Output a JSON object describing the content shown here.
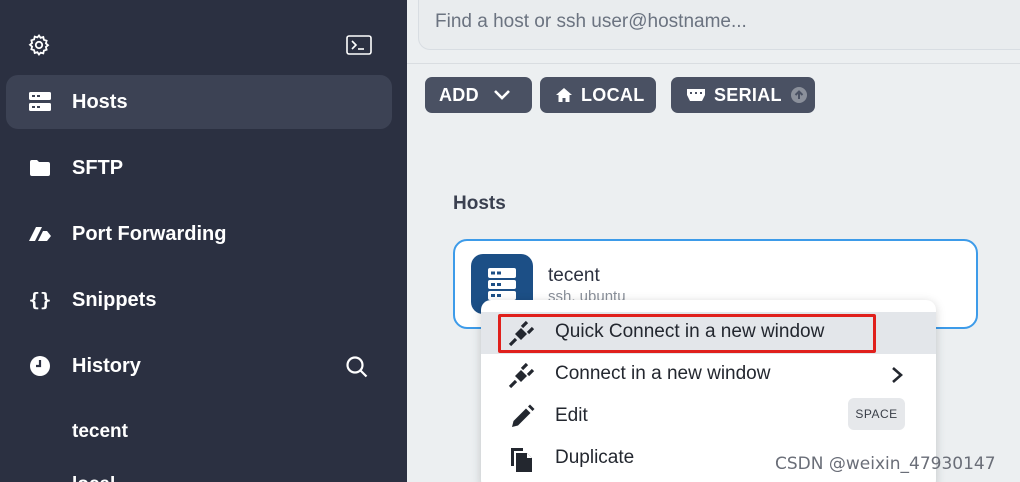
{
  "sidebar": {
    "items": [
      {
        "label": "Hosts",
        "icon": "hosts-icon",
        "active": true
      },
      {
        "label": "SFTP",
        "icon": "folder-icon"
      },
      {
        "label": "Port Forwarding",
        "icon": "port-forwarding-icon"
      },
      {
        "label": "Snippets",
        "icon": "braces-icon"
      },
      {
        "label": "History",
        "icon": "clock-icon"
      }
    ],
    "history": [
      "tecent",
      "local"
    ]
  },
  "search": {
    "placeholder": "Find a host or ssh user@hostname..."
  },
  "toolbar": {
    "add_label": "ADD",
    "local_label": "LOCAL",
    "serial_label": "SERIAL"
  },
  "hosts_section": {
    "title": "Hosts"
  },
  "host": {
    "name": "tecent",
    "subtitle": "ssh, ubuntu"
  },
  "context_menu": {
    "items": [
      {
        "label": "Quick Connect in a new window",
        "icon": "plug-icon"
      },
      {
        "label": "Connect in a new window",
        "icon": "plug-icon"
      },
      {
        "label": "Edit",
        "icon": "pencil-icon",
        "shortcut": "SPACE"
      },
      {
        "label": "Duplicate",
        "icon": "duplicate-icon"
      }
    ]
  },
  "watermark": "CSDN @weixin_47930147",
  "colors": {
    "sidebar_bg": "#2b3041",
    "accent": "#3d9be9",
    "highlight": "#e0201c",
    "host_icon_bg": "#1c4f86"
  }
}
